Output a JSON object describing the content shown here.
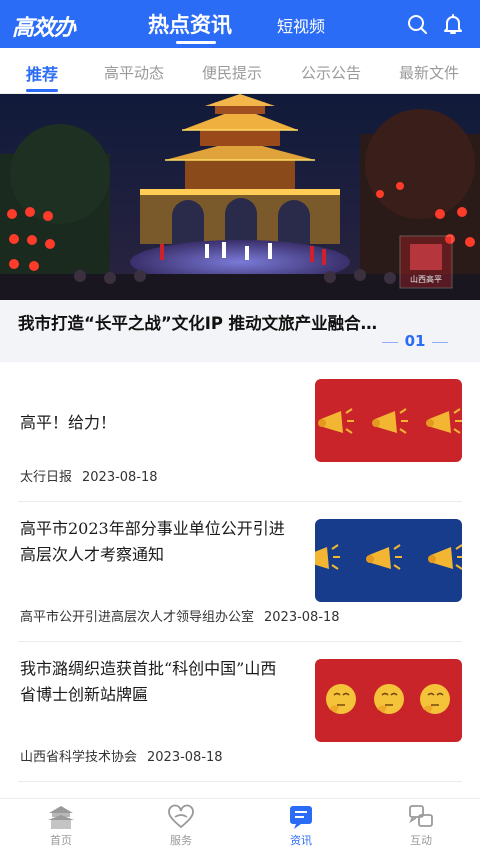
{
  "app": {
    "logo_text": "高效办",
    "top_tabs": [
      {
        "label": "热点资讯",
        "active": true
      },
      {
        "label": "短视频",
        "active": false
      }
    ],
    "icons": {
      "search": "search-icon",
      "notification": "bell-icon"
    },
    "accent_color": "#2b6cf6"
  },
  "category_tabs": [
    {
      "label": "推荐",
      "active": true
    },
    {
      "label": "高平动态",
      "active": false
    },
    {
      "label": "便民提示",
      "active": false
    },
    {
      "label": "公示公告",
      "active": false
    },
    {
      "label": "最新文件",
      "active": false
    }
  ],
  "hero": {
    "title": "我市打造“长平之战”文化IP 推动文旅产业融合…",
    "index": "01",
    "watermark": "山西高平"
  },
  "news": [
    {
      "title": "高平！给力！",
      "source": "太行日报",
      "date": "2023-08-18",
      "thumb_bg": "#c8242a",
      "thumb_icon": "megaphone-icon"
    },
    {
      "title": "高平市2023年部分事业单位公开引进高层次人才考察通知",
      "source": "高平市公开引进高层次人才领导组办公室",
      "date": "2023-08-18",
      "thumb_bg": "#173c8c",
      "thumb_icon": "megaphone-icon"
    },
    {
      "title": "我市潞绸织造获首批“科创中国”山西省博士创新站牌匾",
      "source": "山西省科学技术协会",
      "date": "2023-08-18",
      "thumb_bg": "#c8242a",
      "thumb_icon": "thinking-face-icon"
    }
  ],
  "bottom_nav": [
    {
      "label": "首页",
      "icon": "home-temple-icon",
      "active": false
    },
    {
      "label": "服务",
      "icon": "heart-hands-icon",
      "active": false
    },
    {
      "label": "资讯",
      "icon": "news-chat-icon",
      "active": true
    },
    {
      "label": "互动",
      "icon": "interaction-icon",
      "active": false
    }
  ]
}
